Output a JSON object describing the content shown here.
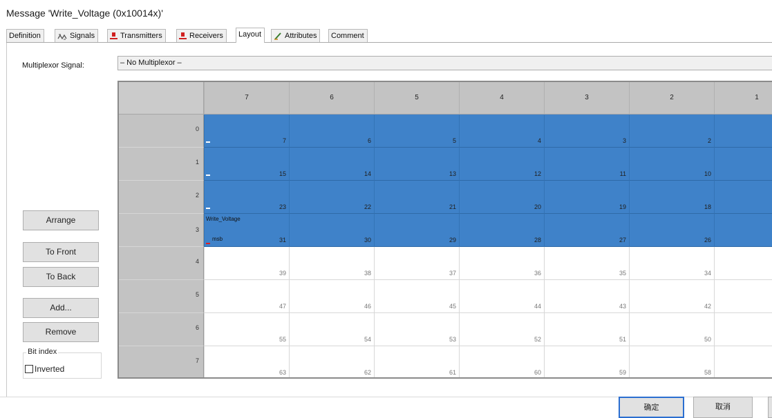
{
  "window": {
    "title": "Message 'Write_Voltage (0x10014x)'"
  },
  "tabs": [
    {
      "label": "Definition",
      "icon": ""
    },
    {
      "label": "Signals",
      "icon": "signals-icon"
    },
    {
      "label": "Transmitters",
      "icon": "person-icon"
    },
    {
      "label": "Receivers",
      "icon": "person-icon"
    },
    {
      "label": "Layout",
      "icon": "",
      "active": true
    },
    {
      "label": "Attributes",
      "icon": "pen-icon"
    },
    {
      "label": "Comment",
      "icon": ""
    }
  ],
  "multiplexor": {
    "label": "Multiplexor Signal:",
    "value": "– No Multiplexor –"
  },
  "layout": {
    "bit_columns": [
      "7",
      "6",
      "5",
      "4",
      "3",
      "2",
      "1"
    ],
    "byte_rows": [
      {
        "byte": "0",
        "bits": [
          "7",
          "6",
          "5",
          "4",
          "3",
          "2",
          ""
        ],
        "filled": true
      },
      {
        "byte": "1",
        "bits": [
          "15",
          "14",
          "13",
          "12",
          "11",
          "10",
          ""
        ],
        "filled": true
      },
      {
        "byte": "2",
        "bits": [
          "23",
          "22",
          "21",
          "20",
          "19",
          "18",
          ""
        ],
        "filled": true
      },
      {
        "byte": "3",
        "bits": [
          "31",
          "30",
          "29",
          "28",
          "27",
          "26",
          ""
        ],
        "filled": true
      },
      {
        "byte": "4",
        "bits": [
          "39",
          "38",
          "37",
          "36",
          "35",
          "34",
          ""
        ],
        "filled": false
      },
      {
        "byte": "5",
        "bits": [
          "47",
          "46",
          "45",
          "44",
          "43",
          "42",
          ""
        ],
        "filled": false
      },
      {
        "byte": "6",
        "bits": [
          "55",
          "54",
          "53",
          "52",
          "51",
          "50",
          ""
        ],
        "filled": false
      },
      {
        "byte": "7",
        "bits": [
          "63",
          "62",
          "61",
          "60",
          "59",
          "58",
          ""
        ],
        "filled": false
      }
    ],
    "signal_label": "Write_Voltage",
    "msb_label": "msb",
    "signal_color": "#3f82c9"
  },
  "buttons": {
    "arrange": "Arrange",
    "to_front": "To Front",
    "to_back": "To Back",
    "add": "Add...",
    "remove": "Remove"
  },
  "bit_index": {
    "group_label": "Bit index",
    "inverted_label": "Inverted",
    "inverted_checked": false
  },
  "dialog": {
    "ok": "确定",
    "cancel": "取消"
  }
}
